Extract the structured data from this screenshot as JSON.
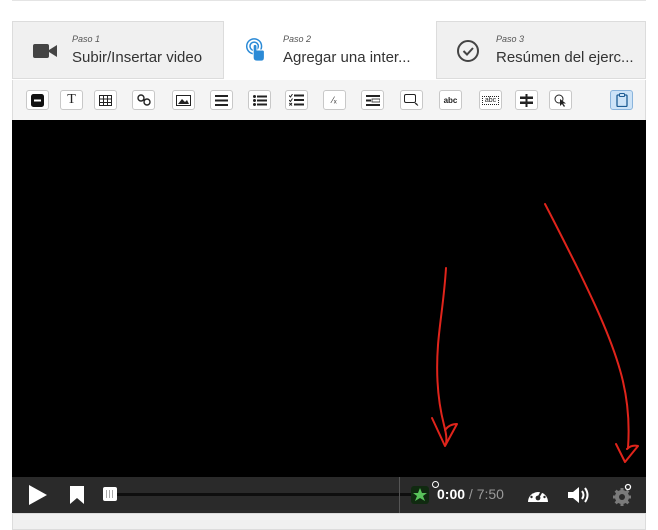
{
  "steps": [
    {
      "kicker": "Paso 1",
      "title": "Subir/Insertar video",
      "icon": "video-camera-icon"
    },
    {
      "kicker": "Paso 2",
      "title": "Agregar una inter...",
      "icon": "touch-hand-icon"
    },
    {
      "kicker": "Paso 3",
      "title": "Resúmen del ejerc...",
      "icon": "check-circle-icon"
    }
  ],
  "toolbar": {
    "text_glyph": "T",
    "fraction_glyph": "⁄ₓ",
    "fill_glyph": "abc",
    "drag_glyph": "abc"
  },
  "player": {
    "current_time": "0:00",
    "separator": " / ",
    "duration": "7:50",
    "progress": 0
  },
  "colors": {
    "accent": "#2b8ad6",
    "annotation": "#e0241b",
    "interaction_marker": "#59c35a"
  }
}
